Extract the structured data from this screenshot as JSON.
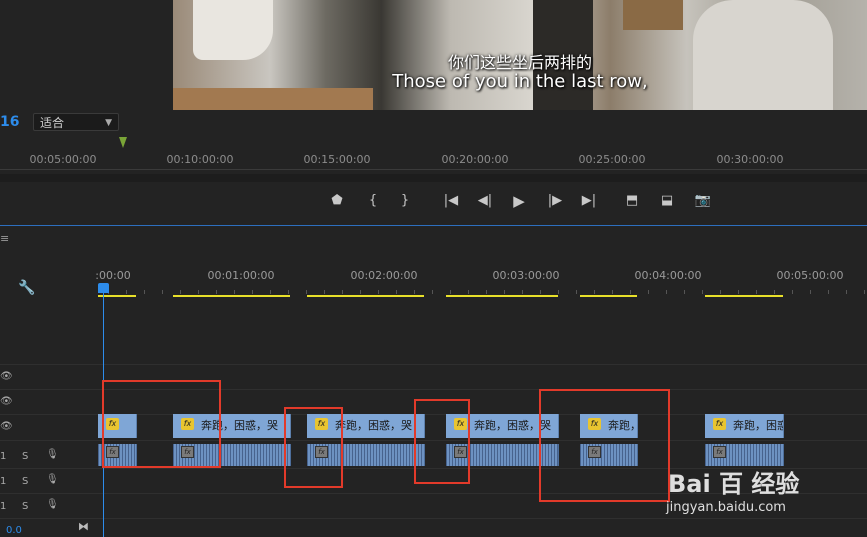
{
  "monitor": {
    "subtitle_cn": "你们这些坐后两排的",
    "subtitle_en": "Those of you in the last row,",
    "timecode_fragment": "16",
    "fit_select": "适合",
    "ruler_ticks": [
      "00:05:00:00",
      "00:10:00:00",
      "00:15:00:00",
      "00:20:00:00",
      "00:25:00:00",
      "00:30:00:00"
    ],
    "transport": {
      "marker": "⬟",
      "in": "{",
      "out": "}",
      "go_in": "|◀",
      "step_back": "◀|",
      "play": "▶",
      "step_fwd": "|▶",
      "go_out": "▶|",
      "lift": "⬒",
      "extract": "⬓",
      "export_frame": "📷"
    }
  },
  "timeline": {
    "menu_glyph": "≡",
    "ruler_ticks": [
      ":00:00",
      "00:01:00:00",
      "00:02:00:00",
      "00:03:00:00",
      "00:04:00:00",
      "00:05:00:00"
    ],
    "tracks": {
      "v_eye": "👁",
      "a_num": "1",
      "a_solo": "S",
      "a_mic": "🎙"
    },
    "clip_fx": "fx",
    "video_clips": [
      {
        "label": ""
      },
      {
        "label": "奔跑，困惑，哭"
      },
      {
        "label": "奔跑，困惑，哭"
      },
      {
        "label": "奔跑，困惑，哭"
      },
      {
        "label": "奔跑，"
      },
      {
        "label": "奔跑，困惑"
      }
    ],
    "zoom_value": "0.0",
    "snap_glyph": "⧓"
  },
  "watermark": {
    "logo": "Bai 百 经验",
    "url": "jingyan.baidu.com"
  },
  "colors": {
    "accent_blue": "#2d8ceb",
    "clip_video": "#7fa6d6",
    "clip_audio": "#6d92c2",
    "work_area": "#e8e02a",
    "annotation_red": "#e23a2a",
    "playhead_monitor": "#7aa537"
  }
}
